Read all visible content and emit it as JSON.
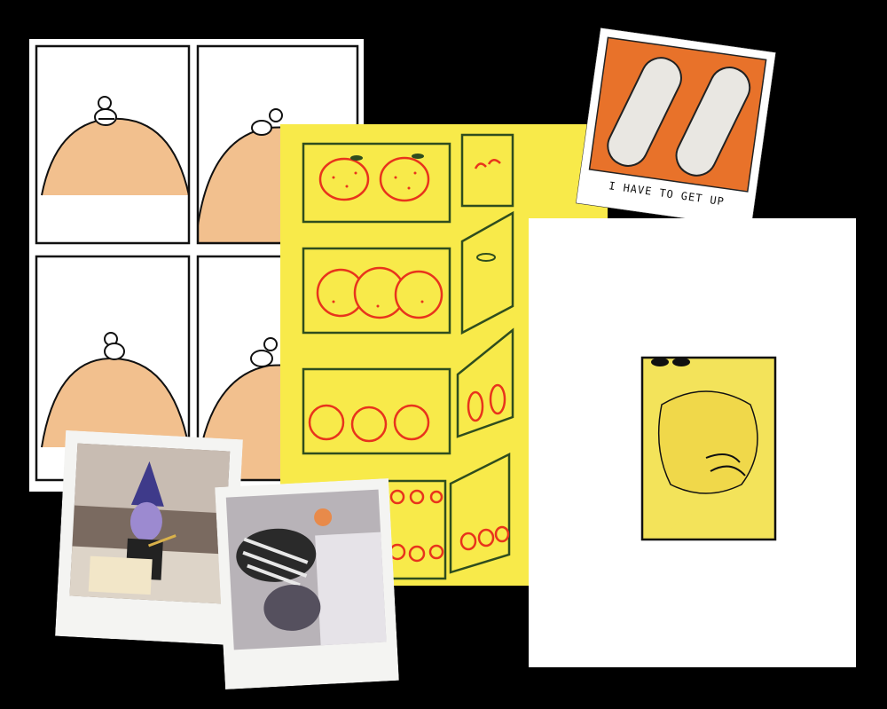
{
  "collage": {
    "background": "#000000",
    "items": [
      {
        "name": "comic-strip-page",
        "subject": "four-panel comic of a small figure sitting on an orange hill",
        "colors": {
          "paper": "#ffffff",
          "hill": "#f2c08e",
          "ink": "#111111"
        }
      },
      {
        "name": "fruit-drawing-page",
        "subject": "marker drawing of oranges and cherries in boxes",
        "colors": {
          "paper": "#f8ea4a",
          "box_ink": "#2f4d1e",
          "fruit_ink": "#e8341c"
        }
      },
      {
        "name": "sticker-card",
        "caption": "I HAVE TO GET UP",
        "colors": {
          "background": "#e8722a",
          "shape": "#e9e7e2"
        }
      },
      {
        "name": "hugging-figure-page",
        "subject": "yellow figure hugging its knees inside a window frame",
        "colors": {
          "paper": "#ffffff",
          "figure": "#f3e35a"
        }
      },
      {
        "name": "polaroid-photo-1",
        "subject": "person in purple mask and wizard hat holding a wand"
      },
      {
        "name": "polaroid-photo-2",
        "subject": "person lying on a bed in a striped shirt"
      }
    ]
  }
}
